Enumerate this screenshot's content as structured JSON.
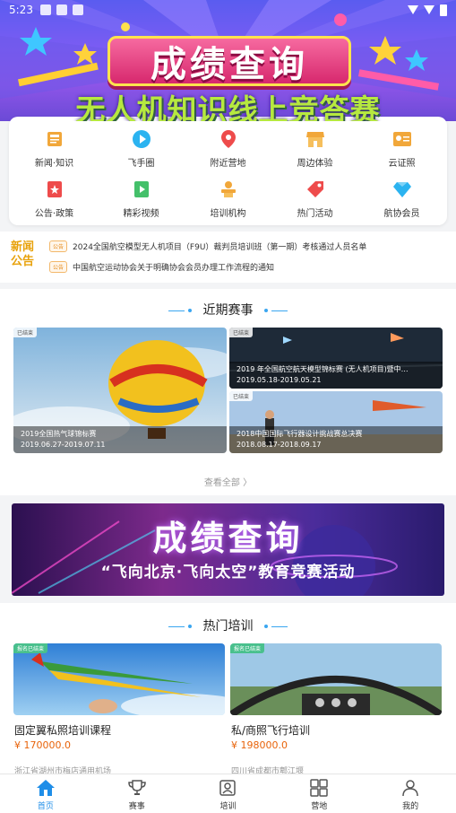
{
  "status_bar": {
    "time": "5:23"
  },
  "top_banner": {
    "title": "成绩查询",
    "subtitle": "无人机知识线上竞答赛"
  },
  "features": [
    {
      "label": "新闻·知识",
      "icon": "news-icon",
      "color": "#f1a73a"
    },
    {
      "label": "飞手圈",
      "icon": "play-circle-icon",
      "color": "#2bb3f0"
    },
    {
      "label": "附近营地",
      "icon": "location-pin-icon",
      "color": "#ee4b4b"
    },
    {
      "label": "周边体验",
      "icon": "storefront-icon",
      "color": "#f1a73a"
    },
    {
      "label": "云证照",
      "icon": "id-card-icon",
      "color": "#f1a73a"
    },
    {
      "label": "公告·政策",
      "icon": "bookmark-icon",
      "color": "#ee4b4b"
    },
    {
      "label": "精彩视频",
      "icon": "video-icon",
      "color": "#44c06a"
    },
    {
      "label": "培训机构",
      "icon": "trainer-icon",
      "color": "#f1a73a"
    },
    {
      "label": "热门活动",
      "icon": "tag-icon",
      "color": "#ee4b4b"
    },
    {
      "label": "航协会员",
      "icon": "diamond-icon",
      "color": "#2bb3f0"
    }
  ],
  "news": {
    "logo_line1": "新闻",
    "logo_line2": "公告",
    "items": [
      {
        "tag": "公告",
        "text": "2024全国航空模型无人机项目（F9U）裁判员培训班（第一期）考核通过人员名单"
      },
      {
        "tag": "公告",
        "text": "中国航空运动协会关于明确协会会员办理工作流程的通知"
      }
    ]
  },
  "events": {
    "heading": "近期赛事",
    "view_all": "查看全部 〉",
    "items": [
      {
        "badge": "已结束",
        "name": "2019全国热气球锦标赛",
        "date": "2019.06.27-2019.07.11"
      },
      {
        "badge": "已结束",
        "name": "2019 年全国航空航天模型锦标赛 (无人机项目)暨中…",
        "date": "2019.05.18-2019.05.21"
      },
      {
        "badge": "已结束",
        "name": "2018中国国际飞行器设计挑战赛总决赛",
        "date": "2018.08.17-2018.09.17"
      }
    ]
  },
  "result_banner": {
    "title": "成绩查询",
    "subtitle": "“飞向北京·飞向太空”教育竞赛活动"
  },
  "training": {
    "heading": "热门培训",
    "items": [
      {
        "badge": "报名已结束",
        "title": "固定翼私照培训课程",
        "price": "¥ 170000.0",
        "location": "浙江省湖州市梅店通用机场"
      },
      {
        "badge": "报名已结束",
        "title": "私/商照飞行培训",
        "price": "¥ 198000.0",
        "location": "四川省成都市郫江堰"
      }
    ]
  },
  "bottom_nav": [
    {
      "label": "首页",
      "icon": "home-icon",
      "active": true
    },
    {
      "label": "赛事",
      "icon": "trophy-icon",
      "active": false
    },
    {
      "label": "培训",
      "icon": "training-icon",
      "active": false
    },
    {
      "label": "营地",
      "icon": "camp-grid-icon",
      "active": false
    },
    {
      "label": "我的",
      "icon": "profile-icon",
      "active": false
    }
  ]
}
